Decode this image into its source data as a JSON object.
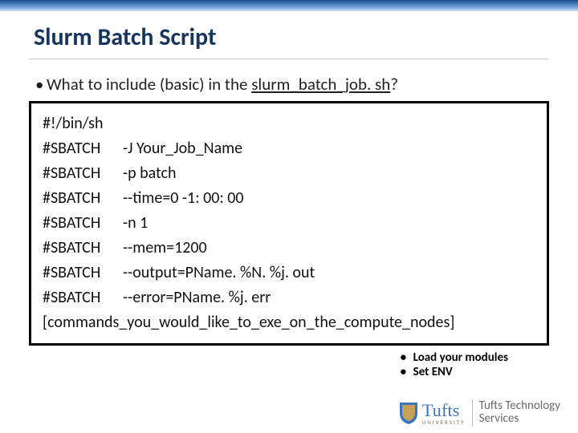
{
  "title": "Slurm Batch Script",
  "intro": {
    "prefix": "What to include (basic) in the ",
    "file": "slurm_batch_job. sh",
    "suffix": "?"
  },
  "code": {
    "shebang": "#!/bin/sh",
    "directives": [
      {
        "k": "#SBATCH",
        "v": "-J   Your_Job_Name"
      },
      {
        "k": "#SBATCH",
        "v": "-p   batch"
      },
      {
        "k": "#SBATCH",
        "v": "--time=0 -1: 00: 00"
      },
      {
        "k": "#SBATCH",
        "v": "-n   1"
      },
      {
        "k": "#SBATCH",
        "v": "--mem=1200"
      },
      {
        "k": "#SBATCH",
        "v": "--output=PName. %N. %j. out"
      },
      {
        "k": "#SBATCH",
        "v": "--error=PName. %j. err"
      }
    ],
    "tail": "[commands_you_would_like_to_exe_on_the_compute_nodes]"
  },
  "notes": [
    "Load your modules",
    "Set ENV"
  ],
  "footer": {
    "brand": "Tufts",
    "sub": "UNIVERSITY",
    "unit1": "Tufts Technology",
    "unit2": "Services"
  }
}
